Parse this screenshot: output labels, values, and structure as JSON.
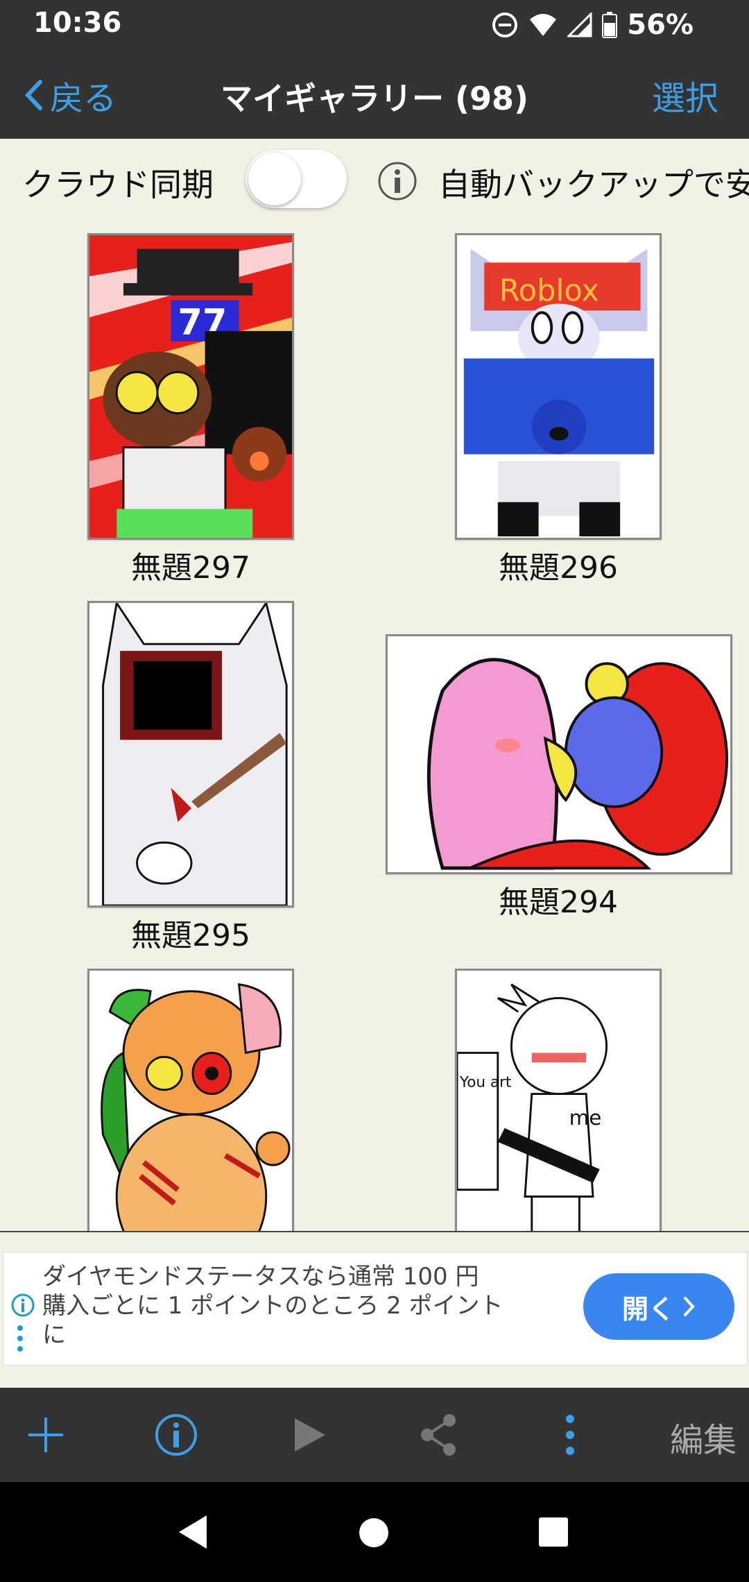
{
  "status": {
    "time": "10:36",
    "battery": "56%"
  },
  "nav": {
    "back_label": "戻る",
    "title": "マイギャラリー (98)",
    "select_label": "選択"
  },
  "sync": {
    "label": "クラウド同期",
    "toggle_on": false,
    "backup_text": "自動バックアップで安"
  },
  "gallery": {
    "items": [
      {
        "caption": "無題297"
      },
      {
        "caption": "無題296"
      },
      {
        "caption": "無題295"
      },
      {
        "caption": "無題294"
      },
      {
        "caption": ""
      },
      {
        "caption": ""
      }
    ],
    "thumb_texts": {
      "roblox": "Roblox",
      "sevens": "77",
      "you_art": "You art",
      "me": "me"
    }
  },
  "ad": {
    "line1": "ダイヤモンドステータスなら通常 100 円",
    "line2": "購入ごとに 1 ポイントのところ 2 ポイント",
    "line3": "に",
    "button_label": "開く"
  },
  "toolbar": {
    "edit_label": "編集"
  },
  "colors": {
    "accent": "#3aa0e8",
    "bar": "#333333",
    "background": "#f2f1e6",
    "ad_button": "#3a86f0"
  }
}
